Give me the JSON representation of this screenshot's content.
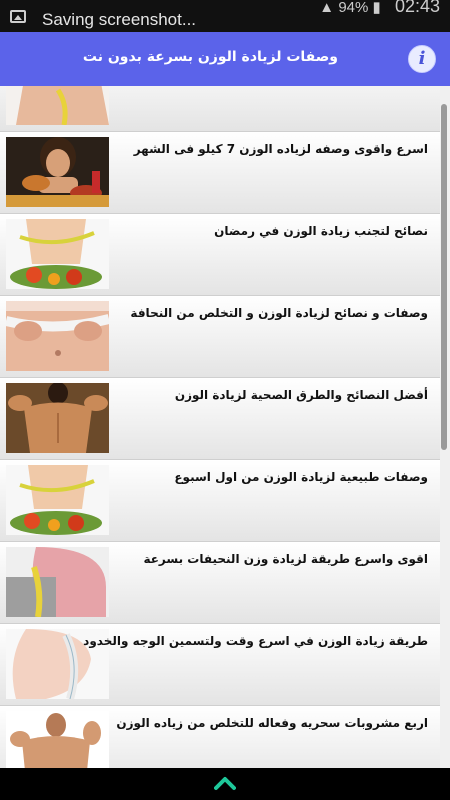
{
  "status_bar": {
    "notification_text": "Saving screenshot...",
    "battery_percent": "94%",
    "time": "02:43"
  },
  "header": {
    "title": "وصفات لزيادة الوزن بسرعة بدون نت",
    "info_label": "i"
  },
  "list": {
    "items": [
      {
        "label": ""
      },
      {
        "label": "اسرع واقوى وصفه لزياده الوزن 7 كيلو فى الشهر"
      },
      {
        "label": "نصائح لتجنب زيادة الوزن في رمضان"
      },
      {
        "label": "وصفات و نصائح لزيادة الوزن و التخلص من النحافة"
      },
      {
        "label": "أفضل النصائح والطرق الصحية لزيادة الوزن"
      },
      {
        "label": "وصفات طبيعية لزيادة الوزن من اول اسبوع"
      },
      {
        "label": "اقوى واسرع طريقة لزيادة وزن النحيفات بسرعة"
      },
      {
        "label": "طريقة زيادة الوزن في اسرع وقت ولتسمين الوجه والخدود"
      },
      {
        "label": "اربع مشروبات سحريه وفعاله للتخلص من زياده الوزن"
      }
    ]
  },
  "icons": {
    "notification": "image-icon",
    "info": "info-icon",
    "scroll_up": "chevron-up-icon"
  },
  "colors": {
    "header": "#5b63ea",
    "nav_arrow": "#1ec79a"
  }
}
